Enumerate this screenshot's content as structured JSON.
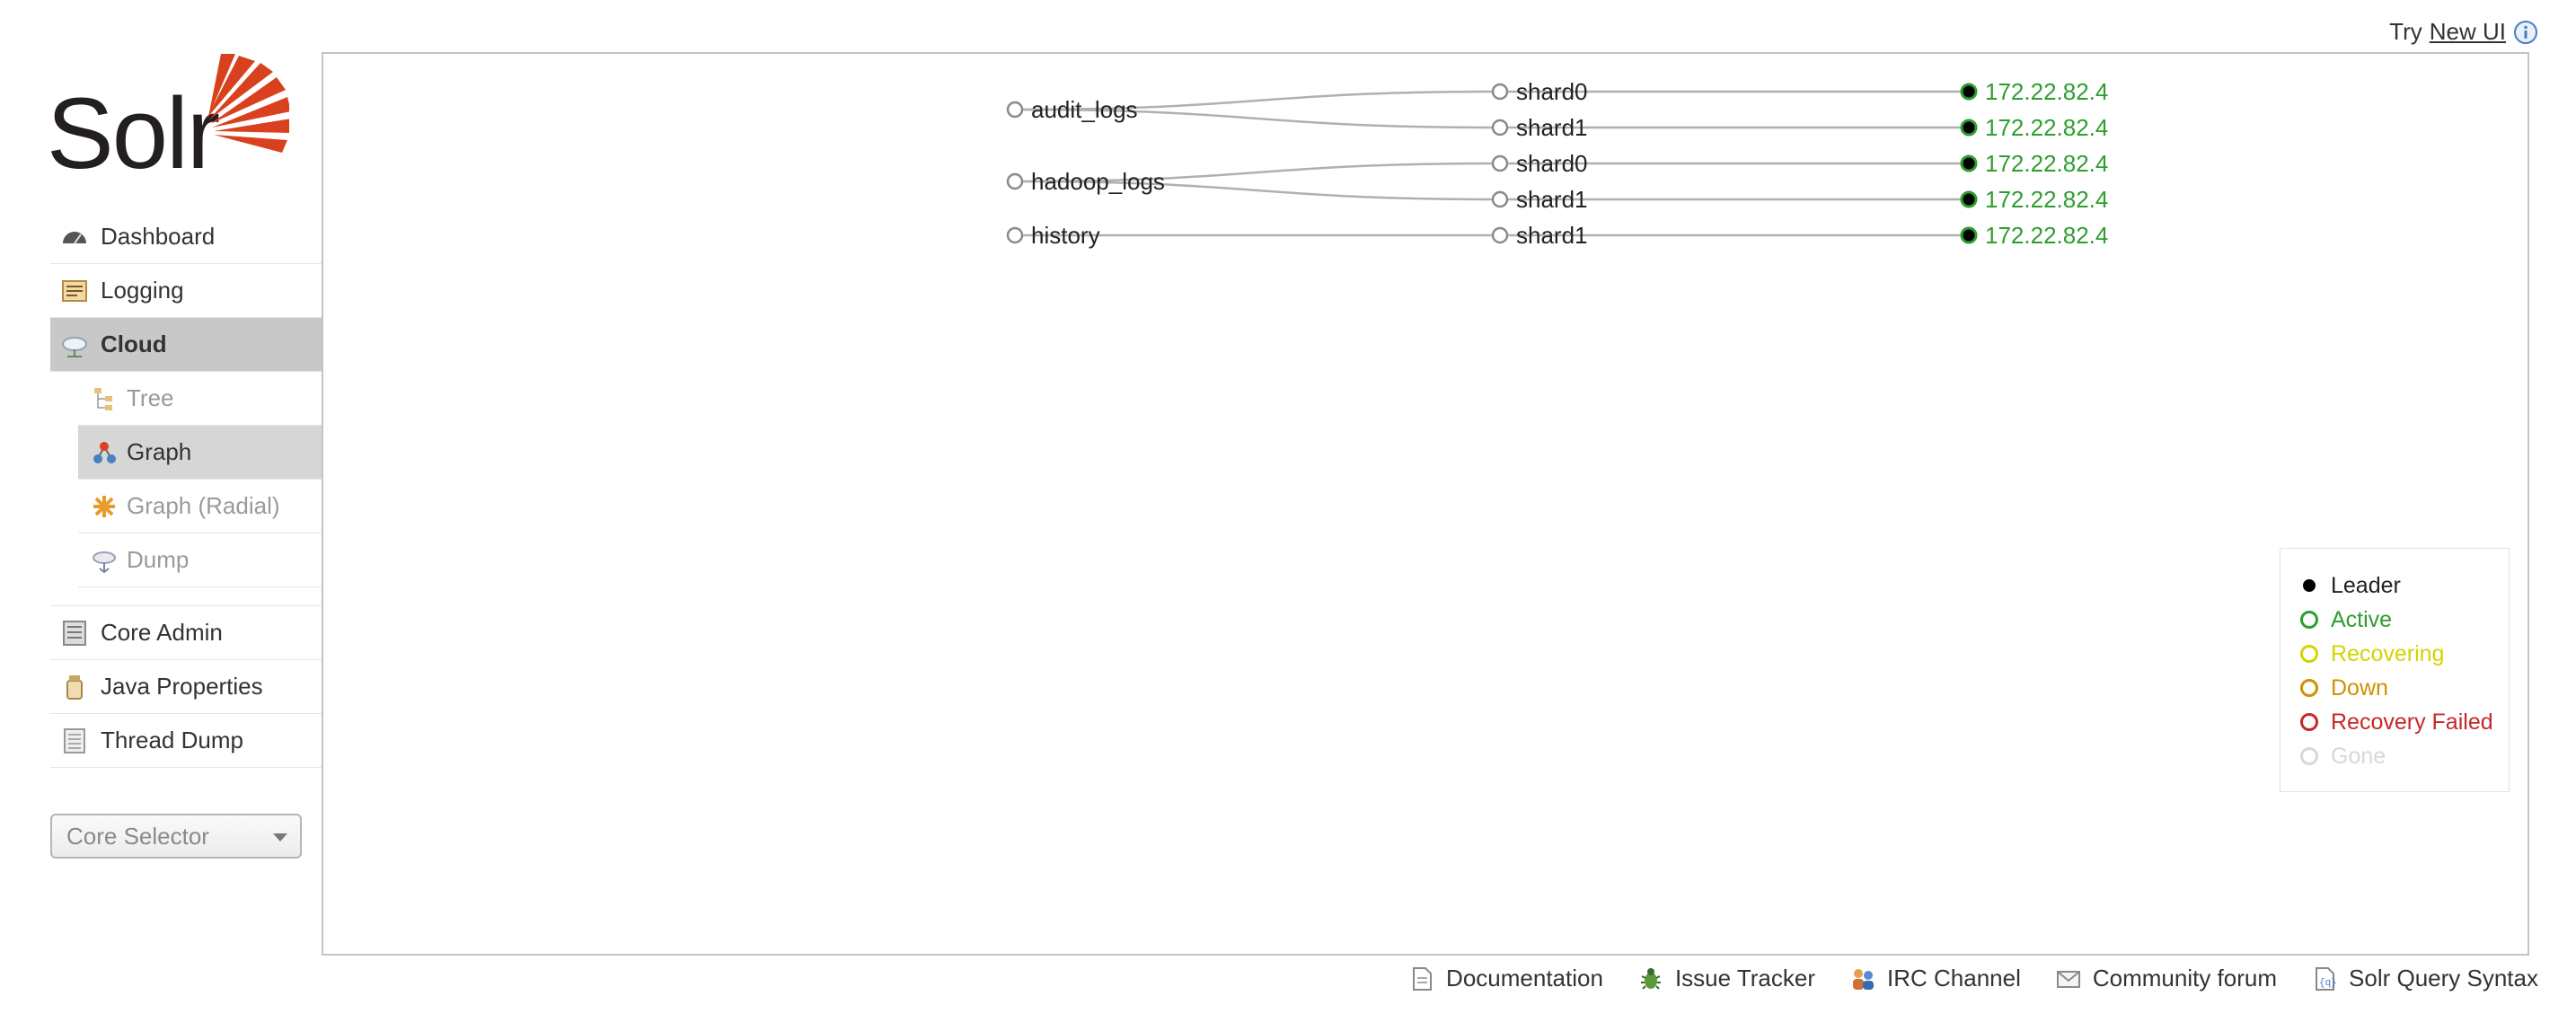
{
  "header": {
    "try_text": "Try",
    "new_ui_link": "New UI",
    "info_icon": "info-icon"
  },
  "logo": {
    "text": "Solr"
  },
  "sidebar": {
    "items": [
      {
        "label": "Dashboard",
        "icon": "dashboard-icon"
      },
      {
        "label": "Logging",
        "icon": "logging-icon"
      },
      {
        "label": "Cloud",
        "icon": "cloud-icon",
        "active": true
      }
    ],
    "cloud_sub": [
      {
        "label": "Tree",
        "icon": "tree-icon"
      },
      {
        "label": "Graph",
        "icon": "graph-icon",
        "active": true
      },
      {
        "label": "Graph (Radial)",
        "icon": "graph-radial-icon"
      },
      {
        "label": "Dump",
        "icon": "dump-icon"
      }
    ],
    "items2": [
      {
        "label": "Core Admin",
        "icon": "core-admin-icon"
      },
      {
        "label": "Java Properties",
        "icon": "java-properties-icon"
      },
      {
        "label": "Thread Dump",
        "icon": "thread-dump-icon"
      }
    ],
    "core_selector": "Core Selector"
  },
  "graph": {
    "collections": [
      {
        "name": "audit_logs",
        "shards": [
          {
            "name": "shard0",
            "host": "172.22.82.4"
          },
          {
            "name": "shard1",
            "host": "172.22.82.4"
          }
        ]
      },
      {
        "name": "hadoop_logs",
        "shards": [
          {
            "name": "shard0",
            "host": "172.22.82.4"
          },
          {
            "name": "shard1",
            "host": "172.22.82.4"
          }
        ]
      },
      {
        "name": "history",
        "shards": [
          {
            "name": "shard1",
            "host": "172.22.82.4"
          }
        ]
      }
    ]
  },
  "legend": {
    "items": [
      {
        "label": "Leader",
        "color": "#000000",
        "filled": true
      },
      {
        "label": "Active",
        "color": "#2e9e2e"
      },
      {
        "label": "Recovering",
        "color": "#d4d400"
      },
      {
        "label": "Down",
        "color": "#d09000"
      },
      {
        "label": "Recovery Failed",
        "color": "#c62828"
      },
      {
        "label": "Gone",
        "color": "#d8d8d8"
      }
    ]
  },
  "footer": {
    "links": [
      {
        "label": "Documentation",
        "icon": "documentation-icon"
      },
      {
        "label": "Issue Tracker",
        "icon": "bug-icon"
      },
      {
        "label": "IRC Channel",
        "icon": "irc-icon"
      },
      {
        "label": "Community forum",
        "icon": "mail-icon"
      },
      {
        "label": "Solr Query Syntax",
        "icon": "query-syntax-icon"
      }
    ]
  }
}
